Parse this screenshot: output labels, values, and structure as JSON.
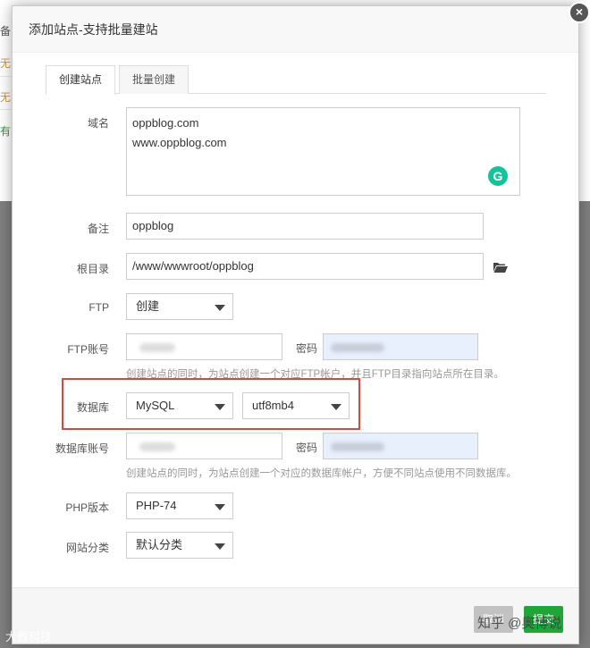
{
  "background": {
    "fragments": [
      "备",
      "无",
      "无",
      "有"
    ]
  },
  "dialog": {
    "title": "添加站点-支持批量建站",
    "close_label": "×",
    "tabs": [
      {
        "label": "创建站点",
        "active": true
      },
      {
        "label": "批量创建",
        "active": false
      }
    ],
    "form": {
      "domain": {
        "label": "域名",
        "lines": [
          "oppblog.com",
          "www.oppblog.com"
        ]
      },
      "remark": {
        "label": "备注",
        "value": "oppblog"
      },
      "root": {
        "label": "根目录",
        "value": "/www/wwwroot/oppblog"
      },
      "ftp": {
        "label": "FTP",
        "selected": "创建"
      },
      "ftp_account": {
        "label": "FTP账号",
        "password_label": "密码",
        "hint": "创建站点的同时，为站点创建一个对应FTP帐户，并且FTP目录指向站点所在目录。"
      },
      "database": {
        "label": "数据库",
        "type_selected": "MySQL",
        "charset_selected": "utf8mb4"
      },
      "db_account": {
        "label": "数据库账号",
        "password_label": "密码",
        "hint": "创建站点的同时，为站点创建一个对应的数据库帐户，方便不同站点使用不同数据库。"
      },
      "php": {
        "label": "PHP版本",
        "selected": "PHP-74"
      },
      "category": {
        "label": "网站分类",
        "selected": "默认分类"
      }
    },
    "footer": {
      "cancel_label": "取消",
      "submit_label": "提交"
    }
  },
  "grammarly_letter": "G",
  "watermarks": {
    "left": "大教科技",
    "right": "知乎 @奥博说"
  },
  "colors": {
    "accent_green": "#20a53a",
    "highlight_red": "#d9473f",
    "grammarly": "#15c39a"
  }
}
